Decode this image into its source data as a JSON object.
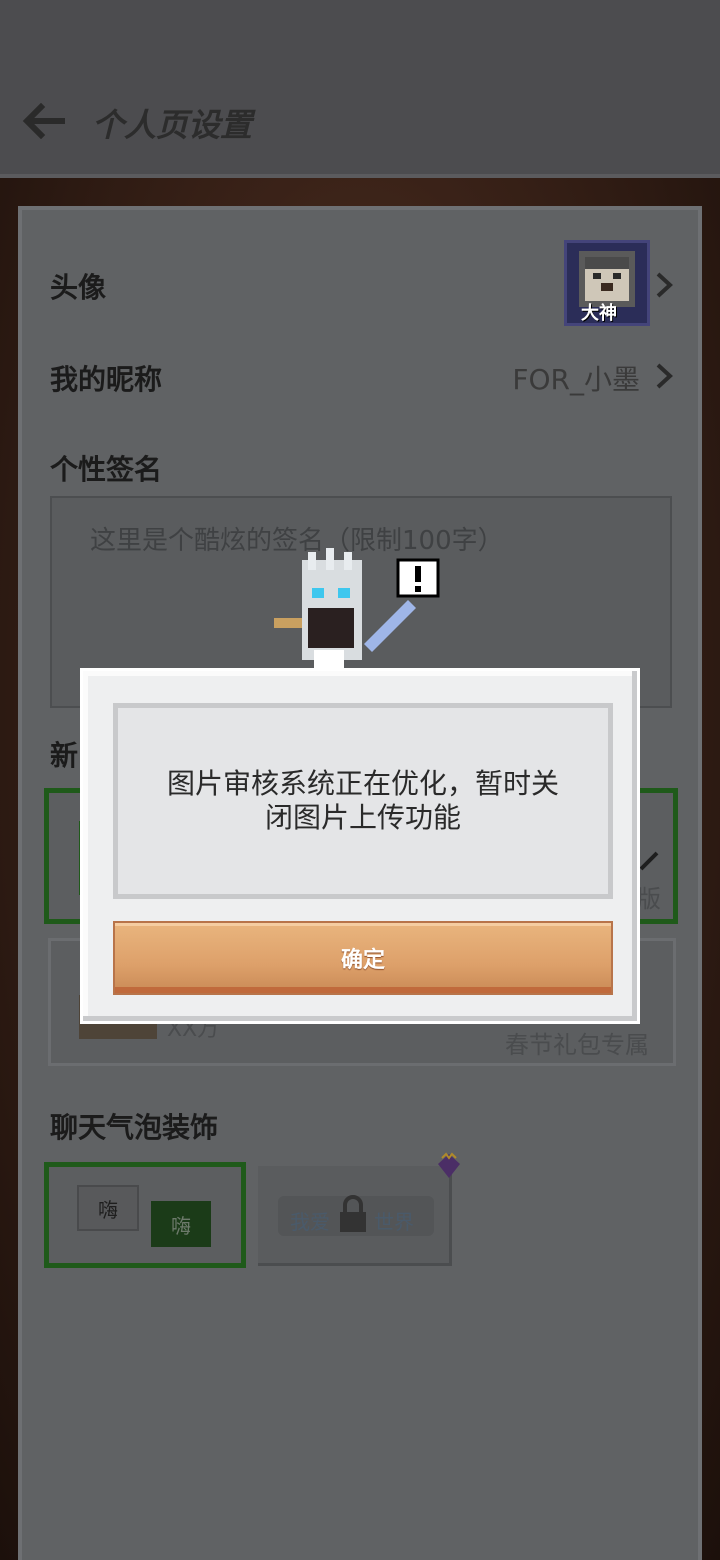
{
  "header": {
    "title": "个人页设置"
  },
  "profile": {
    "avatar_label": "头像",
    "avatar_badge": "大神",
    "nickname_label": "我的昵称",
    "nickname_value": "FOR_小墨",
    "signature_label": "个性签名",
    "signature_placeholder": "这里是个酷炫的签名（限制100字）"
  },
  "sections": {
    "cover_label_partial": "新",
    "cover_card_partial_text": "版",
    "cover_card2_text": "XX万",
    "cover_card2_tag": "春节礼包专属",
    "bubble_label": "聊天气泡装饰",
    "bubble_left_text": "嗨",
    "bubble_right_text": "嗨",
    "bubble2_text_left": "我爱",
    "bubble2_text_right": "世界"
  },
  "dialog": {
    "message": "图片审核系统正在优化，暂时关闭图片上传功能",
    "confirm_label": "确定"
  },
  "colors": {
    "header_bg": "#4c4c4f",
    "panel_bg": "#606264",
    "dialog_bg": "#eeeff0",
    "confirm_btn": "#dda06a",
    "selected_border": "#1f5a1a"
  }
}
